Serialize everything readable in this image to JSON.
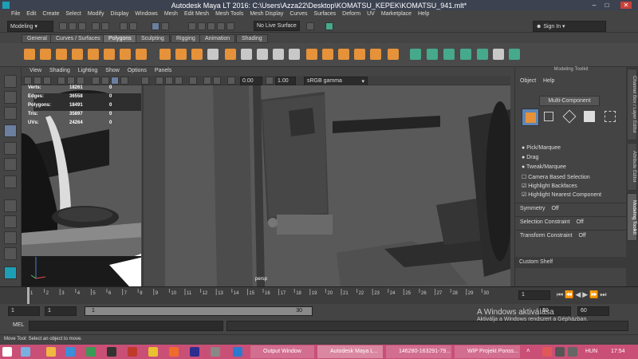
{
  "window": {
    "title": "Autodesk Maya LT 2016: C:\\Users\\Azza22\\Desktop\\KOMATSU_KEPEK\\KOMATSU_941.mlt*",
    "minimize": "–",
    "maximize": "□",
    "close": "✕"
  },
  "menu": [
    "File",
    "Edit",
    "Create",
    "Select",
    "Modify",
    "Display",
    "Windows",
    "Mesh",
    "Edit Mesh",
    "Mesh Tools",
    "Mesh Display",
    "Curves",
    "Surfaces",
    "Deform",
    "UV",
    "Marketplace",
    "Help"
  ],
  "status_line": {
    "mode": "Modeling",
    "live_surface": "No Live Surface",
    "sign_in": "Sign In"
  },
  "shelf_tabs": [
    "General",
    "Curves / Surfaces",
    "Polygons",
    "Sculpting",
    "Rigging",
    "Animation",
    "Shading"
  ],
  "active_shelf_tab": "Polygons",
  "viewport_menu": [
    "View",
    "Shading",
    "Lighting",
    "Show",
    "Options",
    "Panels"
  ],
  "viewport_bar": {
    "value1": "0.00",
    "value2": "1.00",
    "color_space": "sRGB gamma"
  },
  "hud": [
    {
      "label": "Verts:",
      "v1": "18261",
      "v2": "0"
    },
    {
      "label": "Edges:",
      "v1": "36558",
      "v2": "0"
    },
    {
      "label": "Polygons:",
      "v1": "18491",
      "v2": "0"
    },
    {
      "label": "Tris:",
      "v1": "35897",
      "v2": "0"
    },
    {
      "label": "UVs:",
      "v1": "24264",
      "v2": "0"
    }
  ],
  "camera_label": "persp",
  "modeling_toolkit": {
    "title": "Modeling Toolkit",
    "menu": [
      "Object",
      "Help"
    ],
    "multi_component": "Multi-Component",
    "radio_options": [
      "Pick/Marquee",
      "Drag",
      "Tweak/Marquee"
    ],
    "checkbox_camera": "Camera Based Selection",
    "checkbox_backfaces": "Highlight Backfaces",
    "checkbox_nearest": "Highlight Nearest Component",
    "symmetry_label": "Symmetry",
    "symmetry_value": "Off",
    "selection_constraint_label": "Selection Constraint",
    "selection_constraint_value": "Off",
    "transform_constraint_label": "Transform Constraint",
    "transform_constraint_value": "Off",
    "custom_shelf": "Custom Shelf"
  },
  "right_tabs": [
    "Channel Box / Layer Editor",
    "Attribute Editor",
    "Modeling Toolkit"
  ],
  "active_right_tab": "Modeling Toolkit",
  "timeline": {
    "ticks": [
      "1",
      "2",
      "3",
      "4",
      "5",
      "6",
      "7",
      "8",
      "9",
      "10",
      "11",
      "12",
      "13",
      "14",
      "15",
      "16",
      "17",
      "18",
      "19",
      "20",
      "21",
      "22",
      "23",
      "24",
      "25",
      "26",
      "27",
      "28",
      "29",
      "30"
    ],
    "current_frame": "1"
  },
  "range": {
    "start": "1",
    "playback_start": "1",
    "slider_start": "1",
    "slider_end": "30",
    "playback_end": "30",
    "end": "60"
  },
  "command_line_label": "MEL",
  "help_line": "Move Tool: Select an object to move.",
  "watermark": {
    "line1": "A Windows aktiválása",
    "line2": "Aktiválja a Windows rendszert a Gépházban."
  },
  "taskbar": {
    "tasks": [
      "Output Window",
      "Autodesk Maya L...",
      "146280-163291-79...",
      "WIP Projekt Ponss..."
    ],
    "language": "HUN",
    "time": "17:54"
  },
  "colors": {
    "accent_orange": "#e5923a",
    "accent_teal": "#46a98b",
    "taskbar": "#c94f77",
    "panel": "#444444"
  }
}
